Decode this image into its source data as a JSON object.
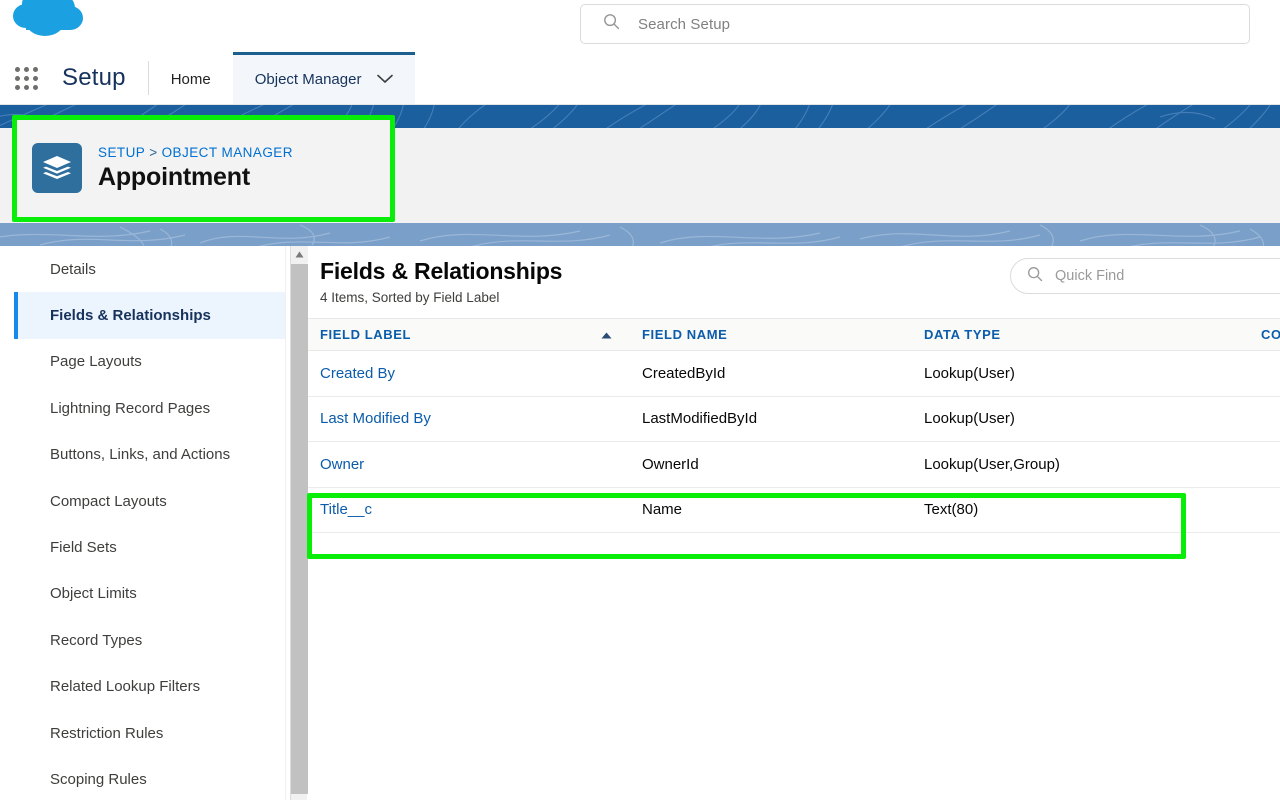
{
  "global": {
    "logo_name": "salesforce-cloud-logo",
    "search": {
      "placeholder": "Search Setup",
      "value": "",
      "icon": "search-icon"
    }
  },
  "setup_nav": {
    "app_launcher_icon": "app-launcher-waffle-icon",
    "title": "Setup",
    "tabs": [
      {
        "label": "Home",
        "active": false,
        "has_chevron": false
      },
      {
        "label": "Object Manager",
        "active": true,
        "has_chevron": true,
        "chevron_icon": "chevron-down-icon"
      }
    ]
  },
  "object_header": {
    "icon": "stacked-layers-icon",
    "breadcrumb": [
      {
        "label": "SETUP"
      },
      {
        "label": "OBJECT MANAGER"
      }
    ],
    "breadcrumb_separator": ">",
    "title": "Appointment"
  },
  "sidebar": {
    "items": [
      {
        "label": "Details",
        "active": false
      },
      {
        "label": "Fields & Relationships",
        "active": true
      },
      {
        "label": "Page Layouts",
        "active": false
      },
      {
        "label": "Lightning Record Pages",
        "active": false
      },
      {
        "label": "Buttons, Links, and Actions",
        "active": false
      },
      {
        "label": "Compact Layouts",
        "active": false
      },
      {
        "label": "Field Sets",
        "active": false
      },
      {
        "label": "Object Limits",
        "active": false
      },
      {
        "label": "Record Types",
        "active": false
      },
      {
        "label": "Related Lookup Filters",
        "active": false
      },
      {
        "label": "Restriction Rules",
        "active": false
      },
      {
        "label": "Scoping Rules",
        "active": false
      }
    ],
    "scrollbar": {
      "up_arrow_icon": "scroll-up-arrow-icon"
    }
  },
  "main": {
    "title": "Fields & Relationships",
    "subtitle": "4 Items, Sorted by Field Label",
    "quick_find": {
      "placeholder": "Quick Find",
      "value": "",
      "icon": "search-icon"
    },
    "table": {
      "columns": [
        {
          "label": "FIELD LABEL",
          "sorted": true,
          "sort_direction": "asc",
          "sort_icon": "sort-ascending-arrow-icon"
        },
        {
          "label": "FIELD NAME",
          "sorted": false
        },
        {
          "label": "DATA TYPE",
          "sorted": false
        },
        {
          "label": "CON",
          "sorted": false
        }
      ],
      "rows": [
        {
          "field_label": "Created By",
          "field_name": "CreatedById",
          "data_type": "Lookup(User)",
          "con": "",
          "highlighted": false
        },
        {
          "field_label": "Last Modified By",
          "field_name": "LastModifiedById",
          "data_type": "Lookup(User)",
          "con": "",
          "highlighted": false
        },
        {
          "field_label": "Owner",
          "field_name": "OwnerId",
          "data_type": "Lookup(User,Group)",
          "con": "",
          "highlighted": false
        },
        {
          "field_label": "Title__c",
          "field_name": "Name",
          "data_type": "Text(80)",
          "con": "",
          "highlighted": true
        }
      ]
    }
  },
  "annotations": {
    "color": "#09EE09",
    "boxes": [
      {
        "target": "object-header-card",
        "name": "annotation-box-object-header"
      },
      {
        "target": "row-title-c",
        "name": "annotation-box-title-row"
      }
    ]
  },
  "colors": {
    "brand_blue": "#1b5f9e",
    "link_blue": "#0070d2",
    "header_link_blue": "#0b5cab",
    "active_rail": "#ecf4fd",
    "active_rail_bar": "#1589ee",
    "icon_tile": "#2e6f9e",
    "annotation_green": "#09EE09"
  }
}
